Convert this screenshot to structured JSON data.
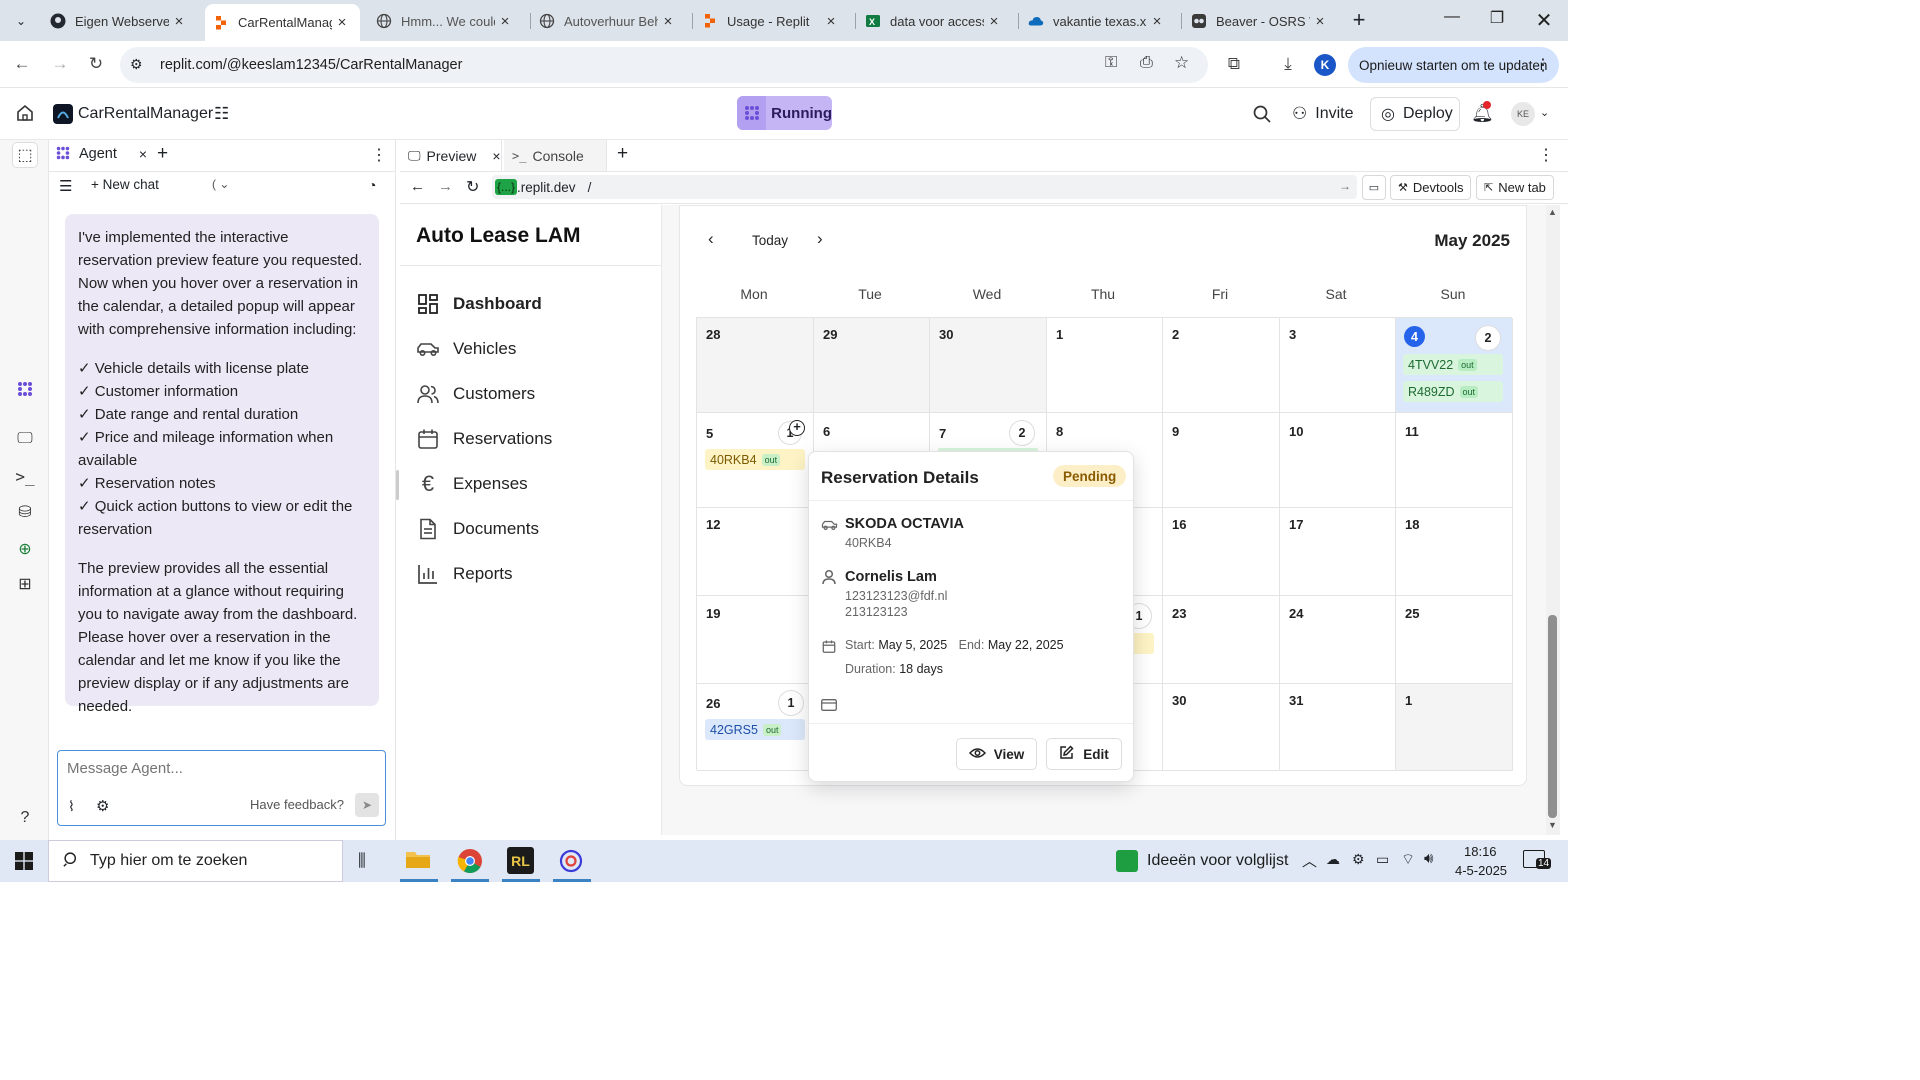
{
  "browser": {
    "tabs": [
      {
        "title": "Eigen Webserver",
        "icon": "github-icon"
      },
      {
        "title": "CarRentalManag",
        "icon": "replit-icon"
      },
      {
        "title": "Hmm... We could",
        "icon": "globe-icon"
      },
      {
        "title": "Autoverhuur Beh",
        "icon": "globe-icon"
      },
      {
        "title": "Usage - Replit",
        "icon": "replit-icon"
      },
      {
        "title": "data voor access",
        "icon": "excel-icon"
      },
      {
        "title": "vakantie texas.xl",
        "icon": "onedrive-icon"
      },
      {
        "title": "Beaver - OSRS W",
        "icon": "osrs-icon"
      }
    ],
    "url": "replit.com/@keeslam12345/CarRentalManager",
    "profile_initial": "K",
    "update_button": "Opnieuw starten om te updaten"
  },
  "replit": {
    "project_name": "CarRentalManager",
    "status": "Running",
    "invite": "Invite",
    "deploy": "Deploy",
    "avatar_initials": "KE",
    "colors": {
      "running_bg": "#c5b5f5",
      "accent": "#4a90d9"
    }
  },
  "agent": {
    "tab_label": "Agent",
    "new_chat": "New chat",
    "message_intro": "I've implemented the interactive reservation preview feature you requested. Now when you hover over a reservation in the calendar, a detailed popup will appear with comprehensive information including:",
    "checklist": [
      "✓ Vehicle details with license plate",
      "✓ Customer information",
      "✓ Date range and rental duration",
      "✓ Price and mileage information when available",
      "✓ Reservation notes",
      "✓ Quick action buttons to view or edit the reservation"
    ],
    "message_outro": "The preview provides all the essential information at a glance without requiring you to navigate away from the dashboard. Please hover over a reservation in the calendar and let me know if you like the preview display or if any adjustments are needed.",
    "input_placeholder": "Message Agent...",
    "feedback": "Have feedback?"
  },
  "preview": {
    "tabs": [
      "Preview",
      "Console"
    ],
    "url_host": ".replit.dev",
    "url_host_prefix": "{...}",
    "url_path": "/",
    "devtools": "Devtools",
    "new_tab": "New tab"
  },
  "app": {
    "brand": "Auto Lease LAM",
    "nav": [
      "Dashboard",
      "Vehicles",
      "Customers",
      "Reservations",
      "Expenses",
      "Documents",
      "Reports"
    ],
    "calendar": {
      "today_label": "Today",
      "month_label": "May 2025",
      "weekdays": [
        "Mon",
        "Tue",
        "Wed",
        "Thu",
        "Fri",
        "Sat",
        "Sun"
      ],
      "weeks": [
        [
          "28",
          "29",
          "30",
          "1",
          "2",
          "3",
          "4"
        ],
        [
          "5",
          "6",
          "7",
          "8",
          "9",
          "10",
          "11"
        ],
        [
          "12",
          "",
          "",
          "",
          "16",
          "17",
          "18"
        ],
        [
          "19",
          "",
          "",
          "",
          "23",
          "24",
          "25"
        ],
        [
          "26",
          "",
          "",
          "",
          "30",
          "31",
          "1"
        ]
      ],
      "counts": {
        "sun_w1": "2",
        "mon_w2": "1",
        "wed_w2": "2",
        "thu_w4": "1",
        "mon_w5": "1"
      },
      "reservations": {
        "r1": {
          "plate": "4TVV22",
          "tag": "out"
        },
        "r2": {
          "plate": "R489ZD",
          "tag": "out"
        },
        "r3": {
          "plate": "40RKB4",
          "tag": "out"
        },
        "r4": {
          "plate": "42GRS5",
          "tag": "out"
        }
      }
    },
    "popup": {
      "title": "Reservation Details",
      "status": "Pending",
      "vehicle_name": "SKODA OCTAVIA",
      "vehicle_plate": "40RKB4",
      "customer_name": "Cornelis Lam",
      "customer_email": "123123123@fdf.nl",
      "customer_phone": "213123123",
      "start_label": "Start:",
      "start_value": "May 5, 2025",
      "end_label": "End:",
      "end_value": "May 22, 2025",
      "duration_label": "Duration:",
      "duration_value": "18 days",
      "view": "View",
      "edit": "Edit"
    }
  },
  "taskbar": {
    "search_placeholder": "Typ hier om te zoeken",
    "widget": "Ideeën voor volglijst",
    "time": "18:16",
    "date": "4-5-2025",
    "notif_count": "14"
  }
}
